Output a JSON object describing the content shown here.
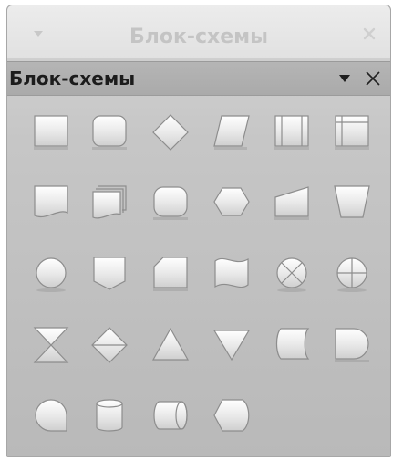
{
  "window": {
    "title": "Блок-схемы"
  },
  "panel": {
    "title": "Блок-схемы"
  },
  "shapes": [
    {
      "row": 0,
      "col": 0,
      "icon": "process-icon"
    },
    {
      "row": 0,
      "col": 1,
      "icon": "alternate-process-icon"
    },
    {
      "row": 0,
      "col": 2,
      "icon": "decision-icon"
    },
    {
      "row": 0,
      "col": 3,
      "icon": "data-icon"
    },
    {
      "row": 0,
      "col": 4,
      "icon": "predefined-process-icon"
    },
    {
      "row": 0,
      "col": 5,
      "icon": "internal-storage-icon"
    },
    {
      "row": 1,
      "col": 0,
      "icon": "document-icon"
    },
    {
      "row": 1,
      "col": 1,
      "icon": "multidocument-icon"
    },
    {
      "row": 1,
      "col": 2,
      "icon": "terminator-icon"
    },
    {
      "row": 1,
      "col": 3,
      "icon": "preparation-icon"
    },
    {
      "row": 1,
      "col": 4,
      "icon": "manual-input-icon"
    },
    {
      "row": 1,
      "col": 5,
      "icon": "manual-operation-icon"
    },
    {
      "row": 2,
      "col": 0,
      "icon": "connector-icon"
    },
    {
      "row": 2,
      "col": 1,
      "icon": "off-page-connector-icon"
    },
    {
      "row": 2,
      "col": 2,
      "icon": "card-icon"
    },
    {
      "row": 2,
      "col": 3,
      "icon": "punched-tape-icon"
    },
    {
      "row": 2,
      "col": 4,
      "icon": "summing-junction-icon"
    },
    {
      "row": 2,
      "col": 5,
      "icon": "or-icon"
    },
    {
      "row": 3,
      "col": 0,
      "icon": "collate-icon"
    },
    {
      "row": 3,
      "col": 1,
      "icon": "sort-icon"
    },
    {
      "row": 3,
      "col": 2,
      "icon": "extract-icon"
    },
    {
      "row": 3,
      "col": 3,
      "icon": "merge-icon"
    },
    {
      "row": 3,
      "col": 4,
      "icon": "stored-data-icon"
    },
    {
      "row": 3,
      "col": 5,
      "icon": "delay-icon"
    },
    {
      "row": 4,
      "col": 0,
      "icon": "sequential-access-icon"
    },
    {
      "row": 4,
      "col": 1,
      "icon": "magnetic-disc-icon"
    },
    {
      "row": 4,
      "col": 2,
      "icon": "direct-access-storage-icon"
    },
    {
      "row": 4,
      "col": 3,
      "icon": "display-icon"
    }
  ]
}
